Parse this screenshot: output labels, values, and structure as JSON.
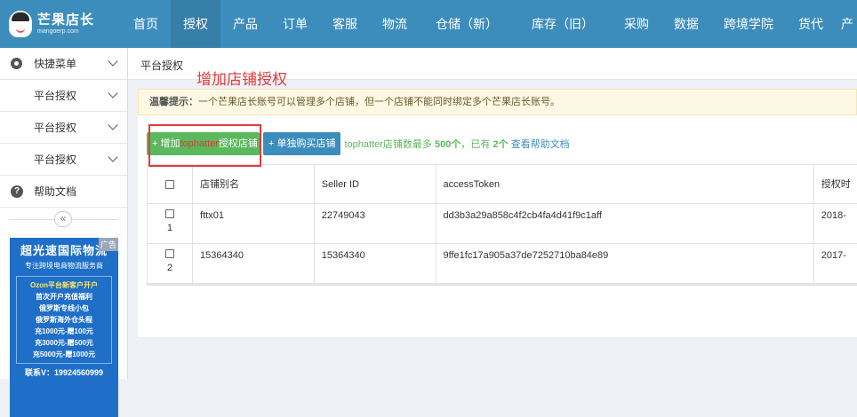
{
  "brand": {
    "name": "芒果店长",
    "domain": "mangoerp.com"
  },
  "nav": [
    "首页",
    "授权",
    "产品",
    "订单",
    "客服",
    "物流",
    "仓储（新）",
    "库存（旧）",
    "采购",
    "数据",
    "跨境学院",
    "货代",
    "产"
  ],
  "sidebar": {
    "quick_menu": "快捷菜单",
    "items": [
      "平台授权",
      "平台授权",
      "平台授权"
    ],
    "help": "帮助文档",
    "collapse": "«"
  },
  "ad": {
    "badge": "广告",
    "title": "超光速国际物流",
    "subtitle": "专注跨境电商物流服务商",
    "lines": [
      "Ozon平台新客户开户",
      "首次开户充值福利",
      "俄罗斯专线小包",
      "俄罗斯海外仓头程",
      "充1000元-赠100元",
      "充3000元-赠500元",
      "充5000元-赠1000元"
    ],
    "phone": "联系V：19924560999"
  },
  "page": {
    "title": "平台授权",
    "annotation": "增加店铺授权",
    "tip_label": "温馨提示：",
    "tip_text": "一个芒果店长账号可以管理多个店铺，但一个店铺不能同时绑定多个芒果店长账号。",
    "add_btn": {
      "prefix": "+ 增加",
      "platform": "tophatter",
      "suffix": "授权店铺"
    },
    "buy_btn": "+ 单独购买店铺",
    "info": {
      "text": "tophatter店铺数最多",
      "max": "500个",
      "sep": "，已有",
      "count": "2个",
      "link": "查看帮助文档"
    }
  },
  "table": {
    "headers": [
      "店铺别名",
      "Seller ID",
      "accessToken",
      "授权时"
    ],
    "rows": [
      {
        "num": "1",
        "alias": "fttx01",
        "seller_id": "22749043",
        "token": "dd3b3a29a858c4f2cb4fa4d41f9c1aff",
        "time": "2018-"
      },
      {
        "num": "2",
        "alias": "15364340",
        "seller_id": "15364340",
        "token": "9ffe1fc17a905a37de7252710ba84e89",
        "time": "2017-"
      }
    ]
  },
  "colors": {
    "topbar": "#3c8dbc",
    "active_nav": "#367fa9",
    "green_button": "#5cb85c",
    "annotation_red": "#e23b3b"
  }
}
